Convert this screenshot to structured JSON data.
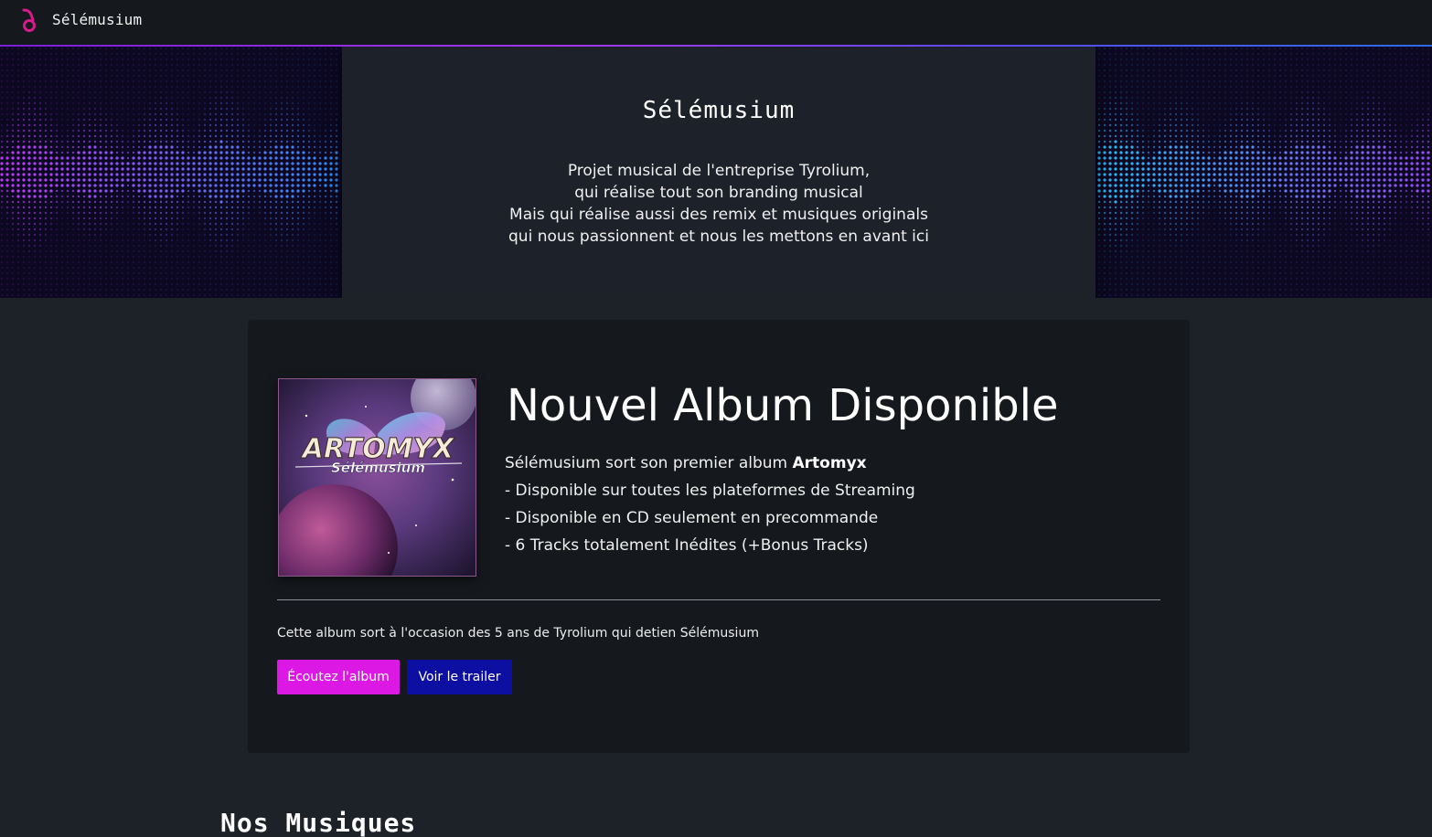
{
  "navbar": {
    "brand": "Sélémusium",
    "icon": "music-note-icon"
  },
  "hero": {
    "title": "Sélémusium",
    "lines": [
      "Projet musical de l'entreprise Tyrolium,",
      "qui réalise tout son branding musical",
      "Mais qui réalise aussi des remix et musiques originals",
      "qui nous passionnent et nous les mettons en avant ici"
    ]
  },
  "album": {
    "cover_title": "ARTOMYX",
    "cover_subtitle": "Sélémusium",
    "heading": "Nouvel Album Disponible",
    "intro_prefix": "Sélémusium sort son premier album ",
    "intro_name": "Artomyx",
    "features": [
      "- Disponible sur toutes les plateformes de Streaming",
      "- Disponible en CD seulement en precommande",
      "- 6 Tracks totalement Inédites (+Bonus Tracks)"
    ],
    "note": "Cette album sort à l'occasion des 5 ans de Tyrolium qui detien Sélémusium",
    "listen_label": "Écoutez l'album",
    "trailer_label": "Voir le trailer"
  },
  "section": {
    "title": "Nos Musiques"
  },
  "colors": {
    "accent_magenta": "#dc18e4",
    "accent_blue": "#0c0fa2",
    "background": "#1d2128",
    "card": "#15181d"
  }
}
